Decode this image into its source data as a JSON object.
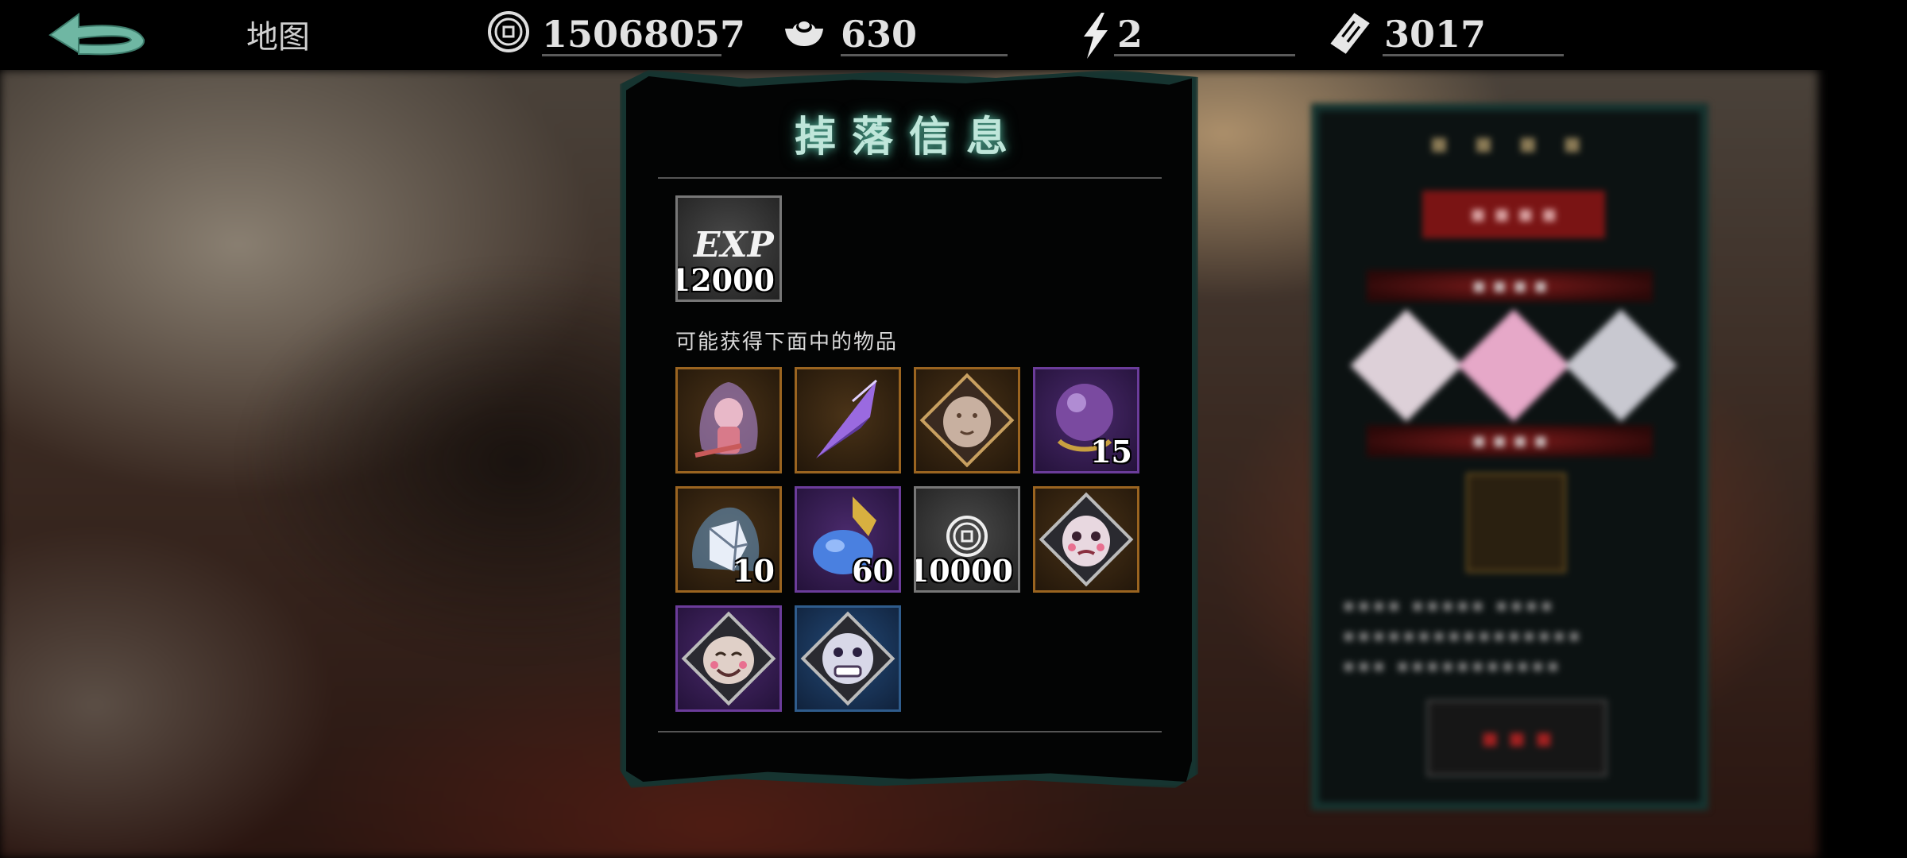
{
  "header": {
    "back_icon": "back-arrow-icon",
    "map_label": "地图",
    "resources": [
      {
        "icon": "coin-icon",
        "value": "15068057"
      },
      {
        "icon": "silver-ingot-icon",
        "value": "630"
      },
      {
        "icon": "lightning-icon",
        "value": "2"
      },
      {
        "icon": "ticket-icon",
        "value": "3017"
      }
    ]
  },
  "drop_panel": {
    "title": "掉落信息",
    "exp": {
      "label": "EXP",
      "amount": "12000"
    },
    "hint": "可能获得下面中的物品",
    "items": [
      {
        "name": "ghost-doll-icon",
        "rarity": "orange",
        "count": ""
      },
      {
        "name": "purple-crystal-icon",
        "rarity": "orange",
        "count": ""
      },
      {
        "name": "stone-face-icon",
        "rarity": "orange",
        "count": ""
      },
      {
        "name": "purple-orb-icon",
        "rarity": "purple",
        "count": "15"
      },
      {
        "name": "ice-cube-icon",
        "rarity": "orange",
        "count": "10"
      },
      {
        "name": "gold-gourd-icon",
        "rarity": "purple",
        "count": "60"
      },
      {
        "name": "coin-icon",
        "rarity": "gray",
        "count": "10000"
      },
      {
        "name": "crying-mask-icon",
        "rarity": "orange",
        "count": ""
      },
      {
        "name": "smiling-mask-icon",
        "rarity": "purple",
        "count": ""
      },
      {
        "name": "grinning-mask-icon",
        "rarity": "blue",
        "count": ""
      }
    ]
  },
  "colors": {
    "orange_border": "#9a6420",
    "purple_border": "#6b3c9a",
    "blue_border": "#2f5c8c",
    "title_glow": "#4fa58f"
  }
}
